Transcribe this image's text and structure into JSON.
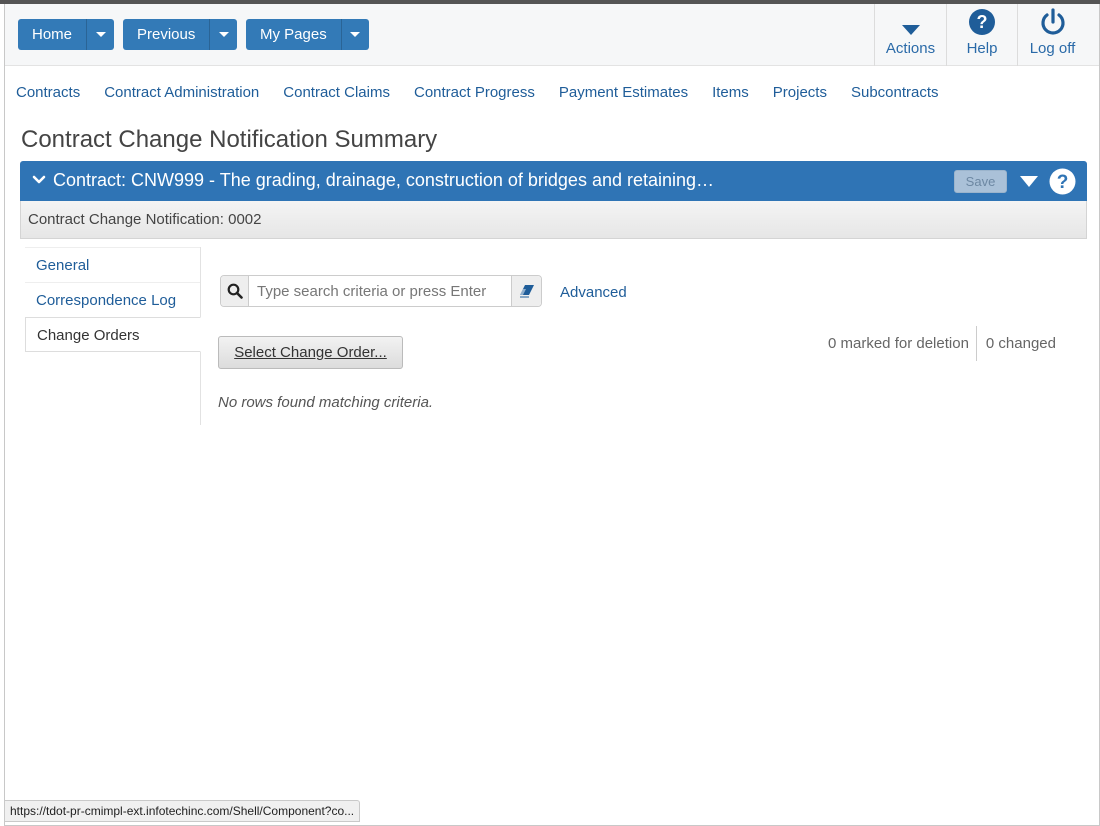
{
  "header": {
    "home_label": "Home",
    "previous_label": "Previous",
    "mypages_label": "My Pages",
    "actions_label": "Actions",
    "help_label": "Help",
    "logoff_label": "Log off"
  },
  "nav": {
    "items": [
      "Contracts",
      "Contract Administration",
      "Contract Claims",
      "Contract Progress",
      "Payment Estimates",
      "Items",
      "Projects",
      "Subcontracts"
    ]
  },
  "page": {
    "title": "Contract Change Notification Summary"
  },
  "panel": {
    "title": "Contract: CNW999 - The grading, drainage, construction of bridges and retaining…",
    "save_label": "Save",
    "subtitle": "Contract Change Notification: 0002"
  },
  "tabs": {
    "items": [
      "General",
      "Correspondence Log",
      "Change Orders"
    ],
    "active": "Change Orders"
  },
  "search": {
    "placeholder": "Type search criteria or press Enter",
    "advanced_label": "Advanced"
  },
  "content": {
    "select_button_label": "Select Change Order...",
    "marked_for_deletion": "0 marked for deletion",
    "changed": "0 changed",
    "empty_message": "No rows found matching criteria."
  },
  "status_bar": {
    "url": "https://tdot-pr-cmimpl-ext.infotechinc.com/Shell/Component?co..."
  },
  "colors": {
    "primary": "#337ab7",
    "panel": "#2f74b5",
    "link": "#1f5d99"
  }
}
